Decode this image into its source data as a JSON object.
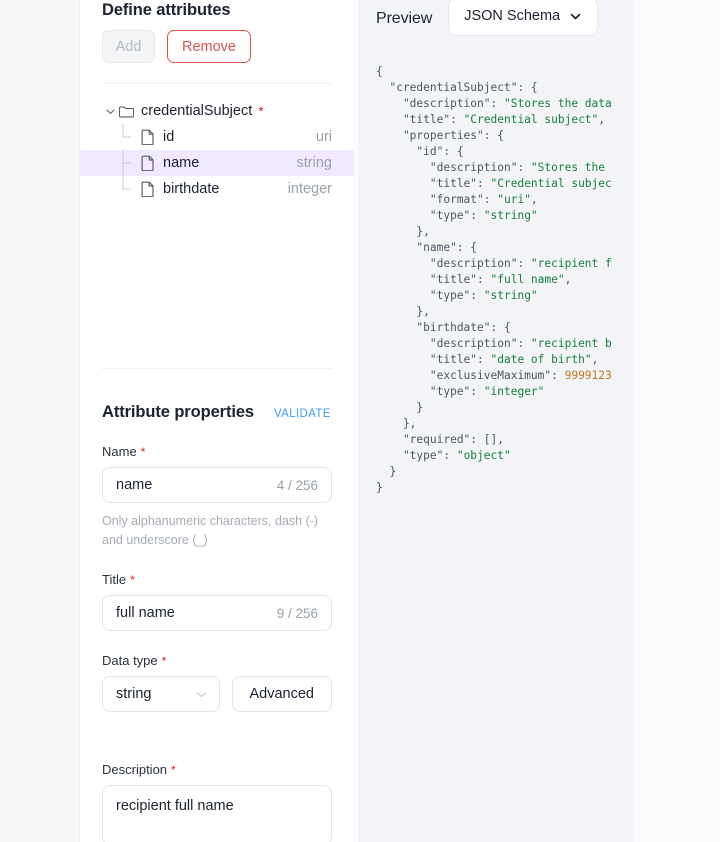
{
  "left_panel": {
    "define_attributes": {
      "title": "Define attributes",
      "add_label": "Add",
      "remove_label": "Remove"
    },
    "tree": {
      "root": {
        "label": "credentialSubject",
        "required_marker": "*",
        "icon": "folder-icon",
        "expanded": true
      },
      "children": [
        {
          "label": "id",
          "type": "uri",
          "icon": "file-icon",
          "selected": false
        },
        {
          "label": "name",
          "type": "string",
          "icon": "file-icon",
          "selected": true
        },
        {
          "label": "birthdate",
          "type": "integer",
          "icon": "file-icon",
          "selected": false
        }
      ]
    },
    "attribute_properties": {
      "title": "Attribute properties",
      "validate_label": "VALIDATE",
      "name_field": {
        "label": "Name",
        "required_marker": "*",
        "value": "name",
        "counter": "4 / 256",
        "hint": "Only alphanumeric characters, dash (-) and underscore (_)"
      },
      "title_field": {
        "label": "Title",
        "required_marker": "*",
        "value": "full name",
        "counter": "9 / 256"
      },
      "data_type_field": {
        "label": "Data type",
        "required_marker": "*",
        "value": "string",
        "advanced_label": "Advanced"
      },
      "description_field": {
        "label": "Description",
        "required_marker": "*",
        "value": "recipient full name"
      }
    }
  },
  "preview_panel": {
    "title": "Preview",
    "format_selected": "JSON Schema",
    "code_lines": [
      [
        {
          "t": "{",
          "c": "key"
        }
      ],
      [
        {
          "t": "  \"credentialSubject\": {",
          "c": "key"
        }
      ],
      [
        {
          "t": "    \"description\": ",
          "c": "key"
        },
        {
          "t": "\"Stores the data",
          "c": "str"
        }
      ],
      [
        {
          "t": "    \"title\": ",
          "c": "key"
        },
        {
          "t": "\"Credential subject\"",
          "c": "str"
        },
        {
          "t": ",",
          "c": "key"
        }
      ],
      [
        {
          "t": "    \"properties\": {",
          "c": "key"
        }
      ],
      [
        {
          "t": "      \"id\": {",
          "c": "key"
        }
      ],
      [
        {
          "t": "        \"description\": ",
          "c": "key"
        },
        {
          "t": "\"Stores the",
          "c": "str"
        }
      ],
      [
        {
          "t": "        \"title\": ",
          "c": "key"
        },
        {
          "t": "\"Credential subjec",
          "c": "str"
        }
      ],
      [
        {
          "t": "        \"format\": ",
          "c": "key"
        },
        {
          "t": "\"uri\"",
          "c": "str"
        },
        {
          "t": ",",
          "c": "key"
        }
      ],
      [
        {
          "t": "        \"type\": ",
          "c": "key"
        },
        {
          "t": "\"string\"",
          "c": "str"
        }
      ],
      [
        {
          "t": "      },",
          "c": "key"
        }
      ],
      [
        {
          "t": "      \"name\": {",
          "c": "key"
        }
      ],
      [
        {
          "t": "        \"description\": ",
          "c": "key"
        },
        {
          "t": "\"recipient f",
          "c": "str"
        }
      ],
      [
        {
          "t": "        \"title\": ",
          "c": "key"
        },
        {
          "t": "\"full name\"",
          "c": "str"
        },
        {
          "t": ",",
          "c": "key"
        }
      ],
      [
        {
          "t": "        \"type\": ",
          "c": "key"
        },
        {
          "t": "\"string\"",
          "c": "str"
        }
      ],
      [
        {
          "t": "      },",
          "c": "key"
        }
      ],
      [
        {
          "t": "      \"birthdate\": {",
          "c": "key"
        }
      ],
      [
        {
          "t": "        \"description\": ",
          "c": "key"
        },
        {
          "t": "\"recipient b",
          "c": "str"
        }
      ],
      [
        {
          "t": "        \"title\": ",
          "c": "key"
        },
        {
          "t": "\"date of birth\"",
          "c": "str"
        },
        {
          "t": ",",
          "c": "key"
        }
      ],
      [
        {
          "t": "        \"exclusiveMaximum\": ",
          "c": "key"
        },
        {
          "t": "9999123",
          "c": "num"
        }
      ],
      [
        {
          "t": "        \"type\": ",
          "c": "key"
        },
        {
          "t": "\"integer\"",
          "c": "str"
        }
      ],
      [
        {
          "t": "      }",
          "c": "key"
        }
      ],
      [
        {
          "t": "    },",
          "c": "key"
        }
      ],
      [
        {
          "t": "    \"required\": [],",
          "c": "key"
        }
      ],
      [
        {
          "t": "    \"type\": ",
          "c": "key"
        },
        {
          "t": "\"object\"",
          "c": "str"
        }
      ],
      [
        {
          "t": "  }",
          "c": "key"
        }
      ],
      [
        {
          "t": "}",
          "c": "key"
        }
      ]
    ]
  },
  "colors": {
    "accent_red": "#D9534F",
    "required_star": "#E02020",
    "link_blue": "#3F9CF5",
    "selection": "#F1E9FD",
    "json_string": "#188038",
    "json_number": "#C07A1E",
    "preview_bg": "#F3F4F8"
  }
}
